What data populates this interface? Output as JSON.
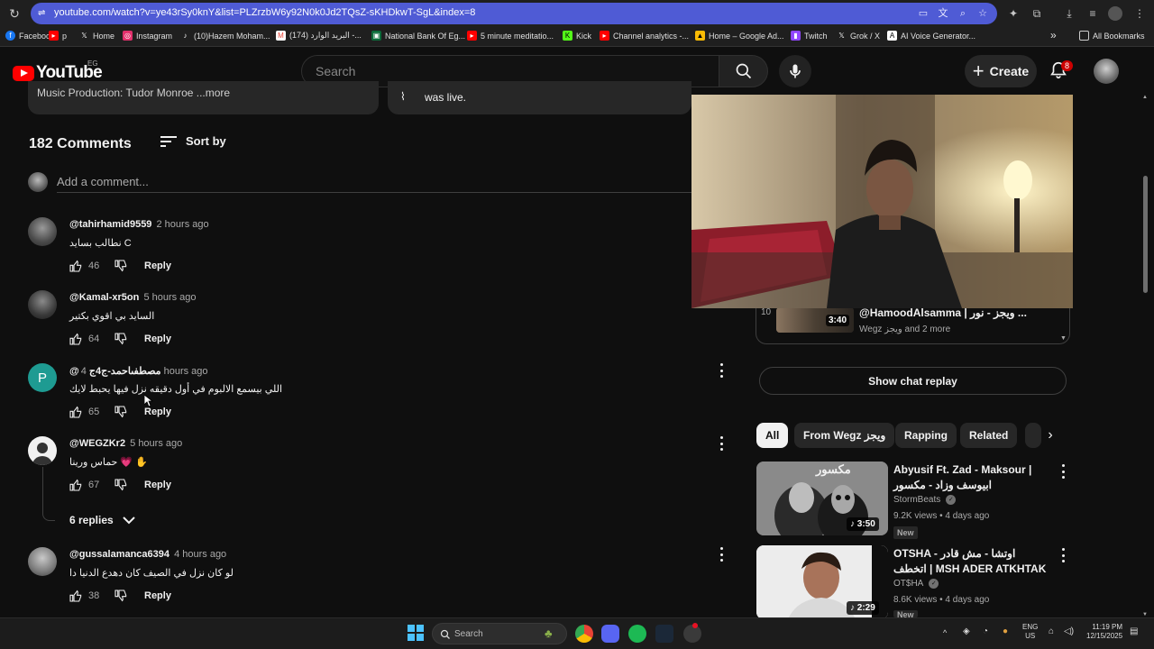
{
  "browser": {
    "url": "youtube.com/watch?v=ye43rSy0knY&list=PLZrzbW6y92N0k0Jd2TQsZ-sKHDkwT-SgL&index=8",
    "bookmarks": [
      {
        "label": "Facebook",
        "color": "#1877f2"
      },
      {
        "label": "p",
        "color": "#ff0000"
      },
      {
        "label": "Home",
        "color": "#000000"
      },
      {
        "label": "Instagram",
        "color": "#e1306c"
      },
      {
        "label": "(10)Hazem Moham...",
        "color": "#000000"
      },
      {
        "label": "(174) البريد الوارد -...",
        "color": "#ea4335"
      },
      {
        "label": "National Bank Of Eg...",
        "color": "#0b6b3a"
      },
      {
        "label": "5 minute meditatio...",
        "color": "#ff0000"
      },
      {
        "label": "Kick",
        "color": "#53fc18"
      },
      {
        "label": "Channel analytics -...",
        "color": "#ff0000"
      },
      {
        "label": "Home – Google Ad...",
        "color": "#fbbc04"
      },
      {
        "label": "Twitch",
        "color": "#9146ff"
      },
      {
        "label": "Grok / X",
        "color": "#000000"
      },
      {
        "label": "AI Voice Generator...",
        "color": "#ffffff"
      }
    ],
    "overflow_label": "»",
    "all_bookmarks": "All Bookmarks"
  },
  "header": {
    "logo_text": "YouTube",
    "country_code": "EG",
    "search_placeholder": "Search",
    "create_label": "Create",
    "notifications_count": "8"
  },
  "top_cards": {
    "left_text": "Music Production: Tudor Monroe ...more",
    "right_text": "was live."
  },
  "comments": {
    "count_label": "182 Comments",
    "sort_label": "Sort by",
    "add_placeholder": "Add a comment...",
    "reply_label": "Reply",
    "items": [
      {
        "author": "@tahirhamid9559",
        "time": "2 hours ago",
        "text": "نطالب بسايد C",
        "likes": "46"
      },
      {
        "author": "@Kamal-xr5on",
        "time": "5 hours ago",
        "text": "السايد بي اقوي بكتير",
        "likes": "64"
      },
      {
        "author": "@مصطفىاحمد-ج4ج",
        "time": "4 hours ago",
        "text": "اللي بيسمع الالبوم في أول دقيقه نزل فيها يحبط لايك",
        "likes": "65"
      },
      {
        "author": "@WEGZKr2",
        "time": "5 hours ago",
        "text": "حماس ورينا 💗 ✋",
        "likes": "67"
      },
      {
        "author": "@gussalamanca6394",
        "time": "4 hours ago",
        "text": "لو كان نزل في الصيف كان دهدع الدنيا دا",
        "likes": "38"
      }
    ],
    "replies_label": "6 replies"
  },
  "playlist_item": {
    "index": "10",
    "duration": "3:40",
    "title": "@HamoodAlsamma | ويجز - نور ...",
    "subtitle": "Wegz ويجز and 2 more"
  },
  "chat_replay_label": "Show chat replay",
  "chips": [
    "All",
    "From Wegz ويجز",
    "Rapping",
    "Related"
  ],
  "related": [
    {
      "title": "Abyusif Ft. Zad - Maksour | ابيوسف وزاد - مكسور",
      "channel": "StormBeats",
      "meta": "9.2K views • 4 days ago",
      "badge": "New",
      "duration": "3:50",
      "thumb_text": "مكسور"
    },
    {
      "title": "OTSHA - اوتشا - مش قادر اتخطف | MSH ADER ATKHTAK",
      "channel": "OT$HA",
      "meta": "8.6K views • 4 days ago",
      "badge": "New",
      "duration": "2:29"
    }
  ],
  "taskbar": {
    "search_label": "Search",
    "lang_line1": "ENG",
    "lang_line2": "US",
    "time": "11:19 PM",
    "date": "12/15/2025"
  },
  "colors": {
    "accent_red": "#ff0000",
    "omnibox": "#4f5bd5",
    "background": "#0f0f0f"
  }
}
